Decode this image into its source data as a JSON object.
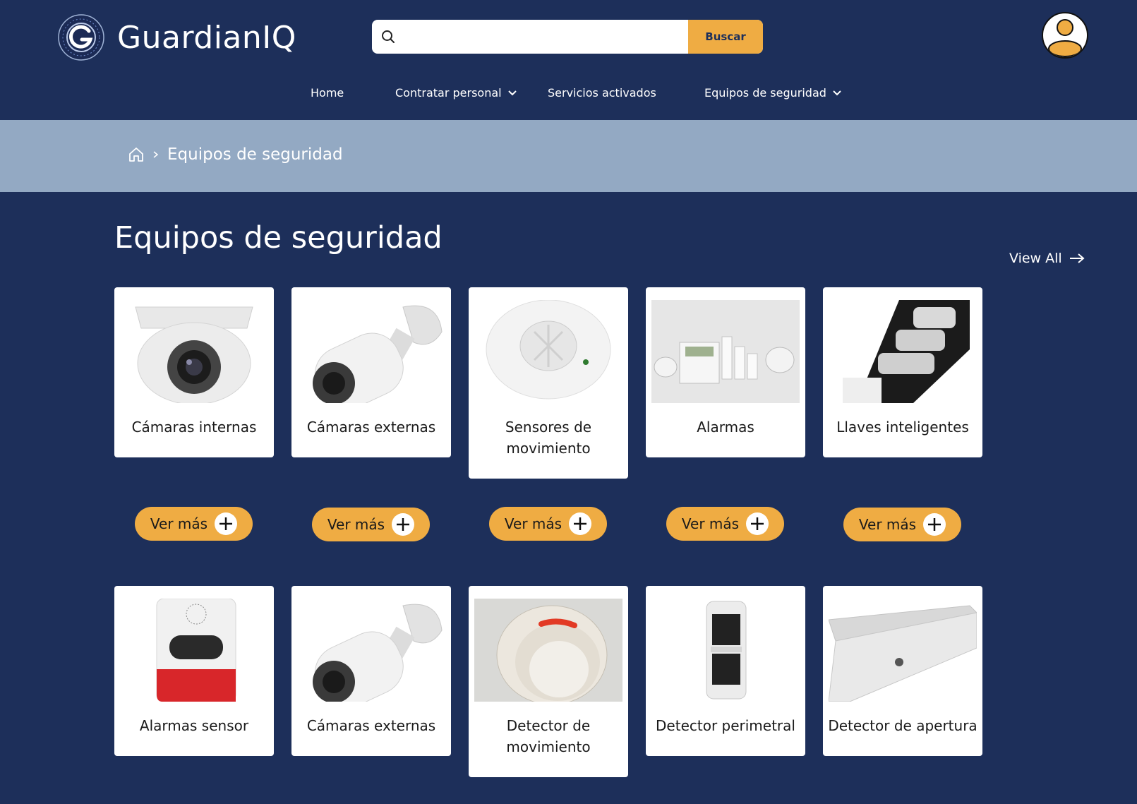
{
  "header": {
    "brand": "GuardianIQ",
    "search": {
      "placeholder": "",
      "button": "Buscar"
    }
  },
  "nav": {
    "items": [
      {
        "label": "Home",
        "dropdown": false
      },
      {
        "label": "Contratar personal",
        "dropdown": true
      },
      {
        "label": "Servicios activados",
        "dropdown": false
      },
      {
        "label": "Equipos de seguridad",
        "dropdown": true
      }
    ]
  },
  "breadcrumb": {
    "current": "Equipos de seguridad"
  },
  "main": {
    "title": "Equipos de seguridad",
    "view_all": "View All",
    "products": [
      {
        "label": "Cámaras internas",
        "icon": "dome-camera-icon"
      },
      {
        "label": "Cámaras externas",
        "icon": "bullet-camera-icon"
      },
      {
        "label": "Sensores de movimiento",
        "icon": "ceiling-motion-sensor-icon"
      },
      {
        "label": "Alarmas",
        "icon": "alarm-kit-icon"
      },
      {
        "label": "Llaves inteligentes",
        "icon": "smart-key-icon"
      },
      {
        "label": "Alarmas sensor",
        "icon": "siren-sensor-icon"
      },
      {
        "label": "Cámaras externas",
        "icon": "bullet-camera-icon"
      },
      {
        "label": "Detector de movimiento",
        "icon": "wall-motion-detector-icon"
      },
      {
        "label": "Detector perimetral",
        "icon": "perimeter-detector-icon"
      },
      {
        "label": "Detector de apertura",
        "icon": "door-contact-icon"
      }
    ],
    "more_button": "Ver más"
  },
  "colors": {
    "background": "#1d2f5a",
    "accent": "#efac43",
    "breadcrumb_bg": "#93a9c3",
    "card": "#ffffff"
  }
}
